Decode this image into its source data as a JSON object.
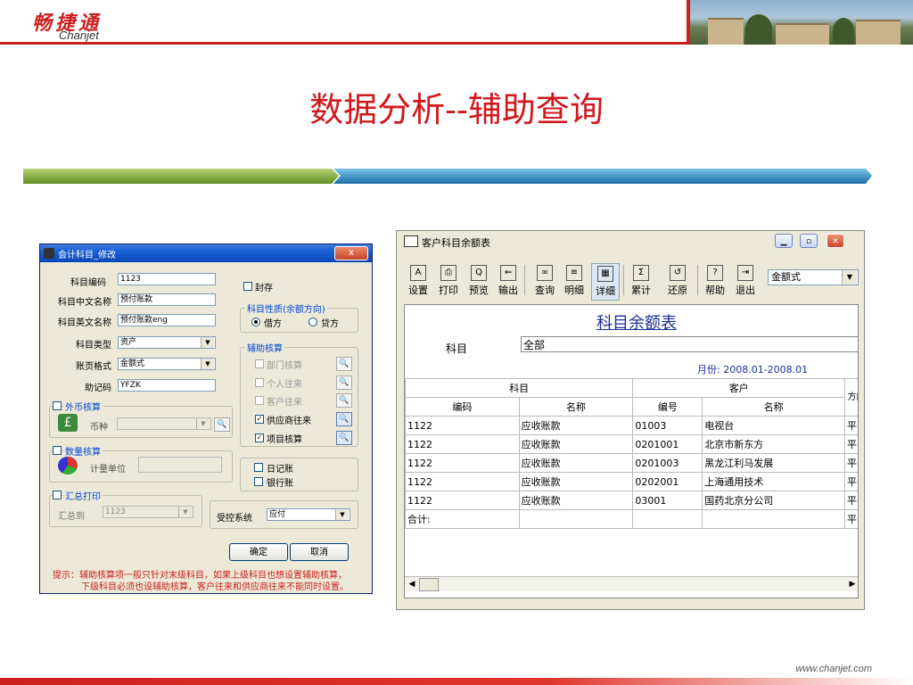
{
  "header": {
    "logo_cn": "畅捷通",
    "logo_en": "Chanjet",
    "title": "数据分析--辅助查询"
  },
  "footer": {
    "url": "www.chanjet.com"
  },
  "colors": {
    "brand_red": "#cc1f1f",
    "bar_green": "#7fb03a",
    "bar_blue": "#2a8fc8",
    "report_blue": "#1b2e9b"
  },
  "dialog": {
    "title": "会计科目_修改",
    "close_label": "x",
    "fields": [
      {
        "label": "科目编码",
        "value": "1123"
      },
      {
        "label": "科目中文名称",
        "value": "预付账款"
      },
      {
        "label": "科目英文名称",
        "value": "预付账款eng"
      },
      {
        "label": "科目类型",
        "value": "资产"
      },
      {
        "label": "账页格式",
        "value": "金额式"
      },
      {
        "label": "助记码",
        "value": "YFZK"
      }
    ],
    "seal": "封存",
    "direction_group": {
      "title": "科目性质(余额方向)",
      "debit": "借方",
      "credit": "贷方"
    },
    "aux_group": {
      "title": "辅助核算",
      "items": [
        {
          "label": "部门核算",
          "checked": false,
          "enabled": false
        },
        {
          "label": "个人往来",
          "checked": false,
          "enabled": false
        },
        {
          "label": "客户往来",
          "checked": false,
          "enabled": false
        },
        {
          "label": "供应商往来",
          "checked": true,
          "enabled": true
        },
        {
          "label": "项目核算",
          "checked": true,
          "enabled": true
        }
      ]
    },
    "currency_group": {
      "title": "外币核算",
      "currency_label": "币种"
    },
    "quantity_group": {
      "title": "数量核算",
      "unit_label": "计量单位"
    },
    "summary_group": {
      "title": "汇总打印",
      "to_label": "汇总到",
      "to_value": "1123"
    },
    "journal": "日记账",
    "bank": "银行账",
    "controlled_system_label": "受控系统",
    "controlled_system_value": "应付",
    "ok": "确定",
    "cancel": "取消",
    "hint_line1": "提示：辅助核算项一般只针对末级科目，如果上级科目也想设置辅助核算，",
    "hint_line2": "下级科目必须也设辅助核算，客户往来和供应商往来不能同时设置。"
  },
  "report_window": {
    "title": "客户科目余额表",
    "toolbar": [
      {
        "icon": "A",
        "label": "设置"
      },
      {
        "icon": "⎙",
        "label": "打印"
      },
      {
        "icon": "Q",
        "label": "预览"
      },
      {
        "icon": "⇐",
        "label": "输出"
      },
      {
        "icon": "∞",
        "label": "查询"
      },
      {
        "icon": "≡",
        "label": "明细"
      },
      {
        "icon": "▦",
        "label": "详细"
      },
      {
        "icon": "Σ",
        "label": "累计"
      },
      {
        "icon": "↺",
        "label": "还原"
      },
      {
        "icon": "?",
        "label": "帮助"
      },
      {
        "icon": "⇥",
        "label": "退出"
      }
    ],
    "mode": "金额式",
    "report_title": "科目余额表",
    "subject_label": "科目",
    "subject_value": "全部",
    "month_range": "月份: 2008.01-2008.01",
    "group_headers": {
      "subject": "科目",
      "customer": "客户",
      "direction": "方向"
    },
    "sub_headers": [
      "编码",
      "名称",
      "编号",
      "名称"
    ],
    "rows": [
      {
        "code": "1122",
        "name": "应收账款",
        "cust_no": "01003",
        "cust_name": "电视台",
        "dir": "平"
      },
      {
        "code": "1122",
        "name": "应收账款",
        "cust_no": "0201001",
        "cust_name": "北京市新东方",
        "dir": "平"
      },
      {
        "code": "1122",
        "name": "应收账款",
        "cust_no": "0201003",
        "cust_name": "黑龙江利马发展",
        "dir": "平"
      },
      {
        "code": "1122",
        "name": "应收账款",
        "cust_no": "0202001",
        "cust_name": "上海通用技术",
        "dir": "平"
      },
      {
        "code": "1122",
        "name": "应收账款",
        "cust_no": "03001",
        "cust_name": "国药北京分公司",
        "dir": "平"
      }
    ],
    "total_label": "合计:",
    "total_dir": "平"
  }
}
